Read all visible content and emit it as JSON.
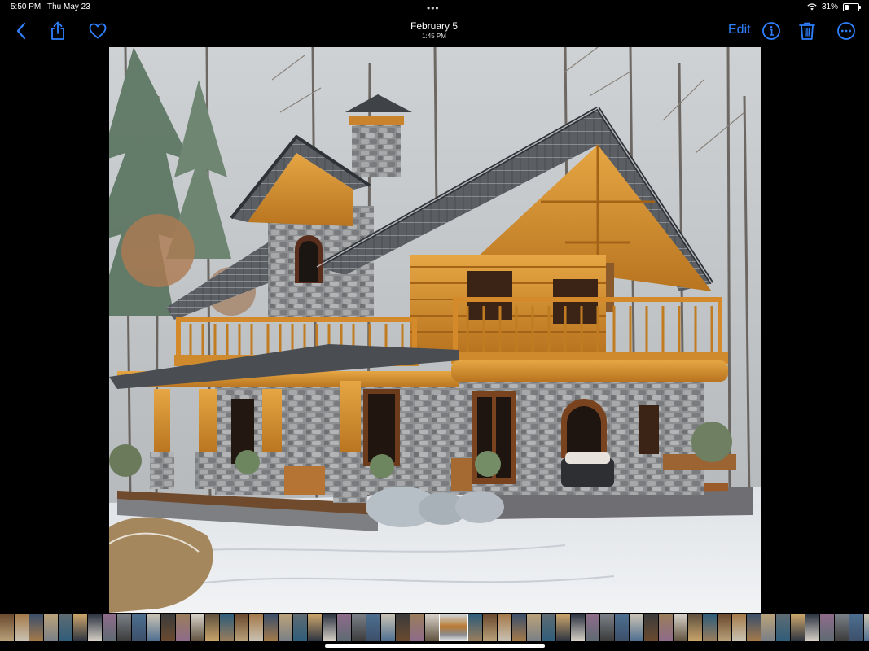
{
  "status_bar": {
    "time": "5:50 PM",
    "date": "Thu May 23",
    "battery_percent": "31%",
    "battery_level": 0.31,
    "wifi_icon": "wifi-icon"
  },
  "toolbar": {
    "title": "February 5",
    "subtitle": "1:45 PM",
    "edit_label": "Edit",
    "accent_color": "#2f80ff"
  },
  "photo": {
    "subject": "log-cabin-snow",
    "colors": {
      "sky": "#d9dde0",
      "wood": "#d79534",
      "stone": "#8c8c8c",
      "roof": "#4a4d52",
      "snow": "#e9ecef"
    }
  },
  "thumbnails": {
    "count": 62,
    "current_index": 30,
    "palette": [
      "#6b4a2f",
      "#a57a4a",
      "#3c4f6a",
      "#b9a27a",
      "#5e6b73",
      "#caa46a",
      "#2d3442",
      "#8e6b8a",
      "#7a7f86",
      "#4d6e8f",
      "#c9c2b4",
      "#3b3b3b",
      "#9a7d5c",
      "#d6d0c6",
      "#60523f",
      "#2f5d7a"
    ]
  }
}
